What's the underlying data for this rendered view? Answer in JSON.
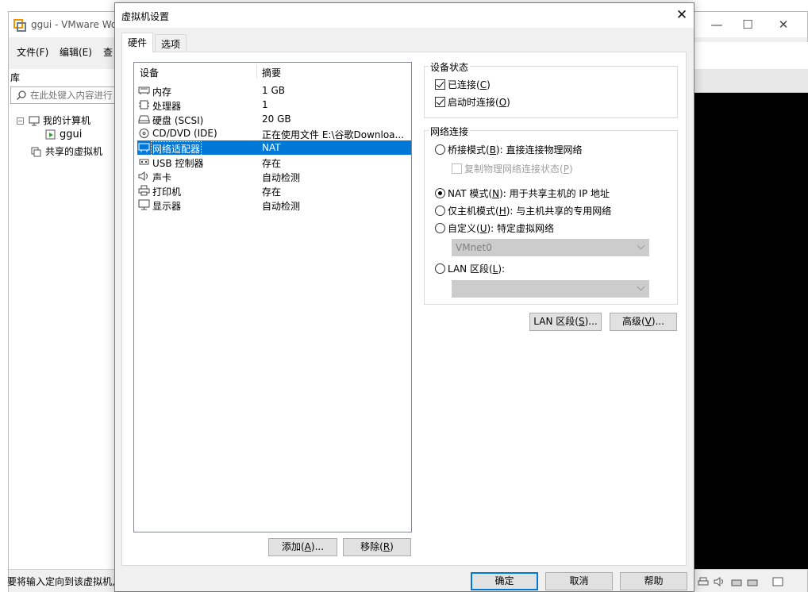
{
  "background_window": {
    "title": "ggui - VMware Wo",
    "menu": [
      "文件(F)",
      "编辑(E)",
      "查"
    ],
    "library_label": "库",
    "search_placeholder": "在此处键入内容进行",
    "tree": {
      "my_computer": "我的计算机",
      "vm": "ggui",
      "shared": "共享的虚拟机"
    },
    "status_text": "要将输入定向到该虚拟机,",
    "window_controls": [
      "—",
      "☐",
      "✕"
    ]
  },
  "dialog": {
    "title": "虚拟机设置",
    "close_glyph": "✕",
    "tabs": [
      {
        "label": "硬件",
        "active": true
      },
      {
        "label": "选项",
        "active": false
      }
    ],
    "device_list": {
      "headers": {
        "device": "设备",
        "summary": "摘要"
      },
      "rows": [
        {
          "icon": "memory-icon",
          "name": "内存",
          "summary": "1 GB",
          "selected": false
        },
        {
          "icon": "processor-icon",
          "name": "处理器",
          "summary": "1",
          "selected": false
        },
        {
          "icon": "harddisk-icon",
          "name": "硬盘 (SCSI)",
          "summary": "20 GB",
          "selected": false
        },
        {
          "icon": "cd-dvd-icon",
          "name": "CD/DVD (IDE)",
          "summary": "正在使用文件 E:\\谷歌Downloa...",
          "selected": false
        },
        {
          "icon": "network-adapter-icon",
          "name": "网络适配器",
          "summary": "NAT",
          "selected": true
        },
        {
          "icon": "usb-icon",
          "name": "USB 控制器",
          "summary": "存在",
          "selected": false
        },
        {
          "icon": "sound-card-icon",
          "name": "声卡",
          "summary": "自动检测",
          "selected": false
        },
        {
          "icon": "printer-icon",
          "name": "打印机",
          "summary": "存在",
          "selected": false
        },
        {
          "icon": "display-icon",
          "name": "显示器",
          "summary": "自动检测",
          "selected": false
        }
      ]
    },
    "list_buttons": {
      "add": {
        "text": "添加(",
        "key": "A",
        "tail": ")..."
      },
      "remove": {
        "text": "移除(",
        "key": "R",
        "tail": ")"
      }
    },
    "device_status": {
      "title": "设备状态",
      "connected": {
        "text": "已连接(",
        "key": "C",
        "tail": ")",
        "checked": true
      },
      "connect_on_power": {
        "text": "启动时连接(",
        "key": "O",
        "tail": ")",
        "checked": true
      }
    },
    "network_connection": {
      "title": "网络连接",
      "bridged": {
        "text": "桥接模式(",
        "key": "B",
        "tail": "): 直接连接物理网络",
        "selected": false
      },
      "replicate": {
        "text": "复制物理网络连接状态(",
        "key": "P",
        "tail": ")",
        "checked": false,
        "enabled": false
      },
      "nat": {
        "text": "NAT 模式(",
        "key": "N",
        "tail": "): 用于共享主机的 IP 地址",
        "selected": true
      },
      "host_only": {
        "text": "仅主机模式(",
        "key": "H",
        "tail": "): 与主机共享的专用网络",
        "selected": false
      },
      "custom": {
        "text": "自定义(",
        "key": "U",
        "tail": "): 特定虚拟网络",
        "selected": false
      },
      "custom_value": "VMnet0",
      "lan_segment": {
        "text": "LAN 区段(",
        "key": "L",
        "tail": "):",
        "selected": false
      },
      "lan_segment_value": ""
    },
    "advanced_buttons": {
      "lan_segments": {
        "text": "LAN 区段(",
        "key": "S",
        "tail": ")..."
      },
      "advanced": {
        "text": "高级(",
        "key": "V",
        "tail": ")..."
      }
    },
    "footer_buttons": {
      "ok": "确定",
      "cancel": "取消",
      "help": "帮助"
    }
  },
  "colors": {
    "selection": "#0078d7",
    "dialog_bg": "#f0f0f0",
    "console_bg": "#000000"
  }
}
